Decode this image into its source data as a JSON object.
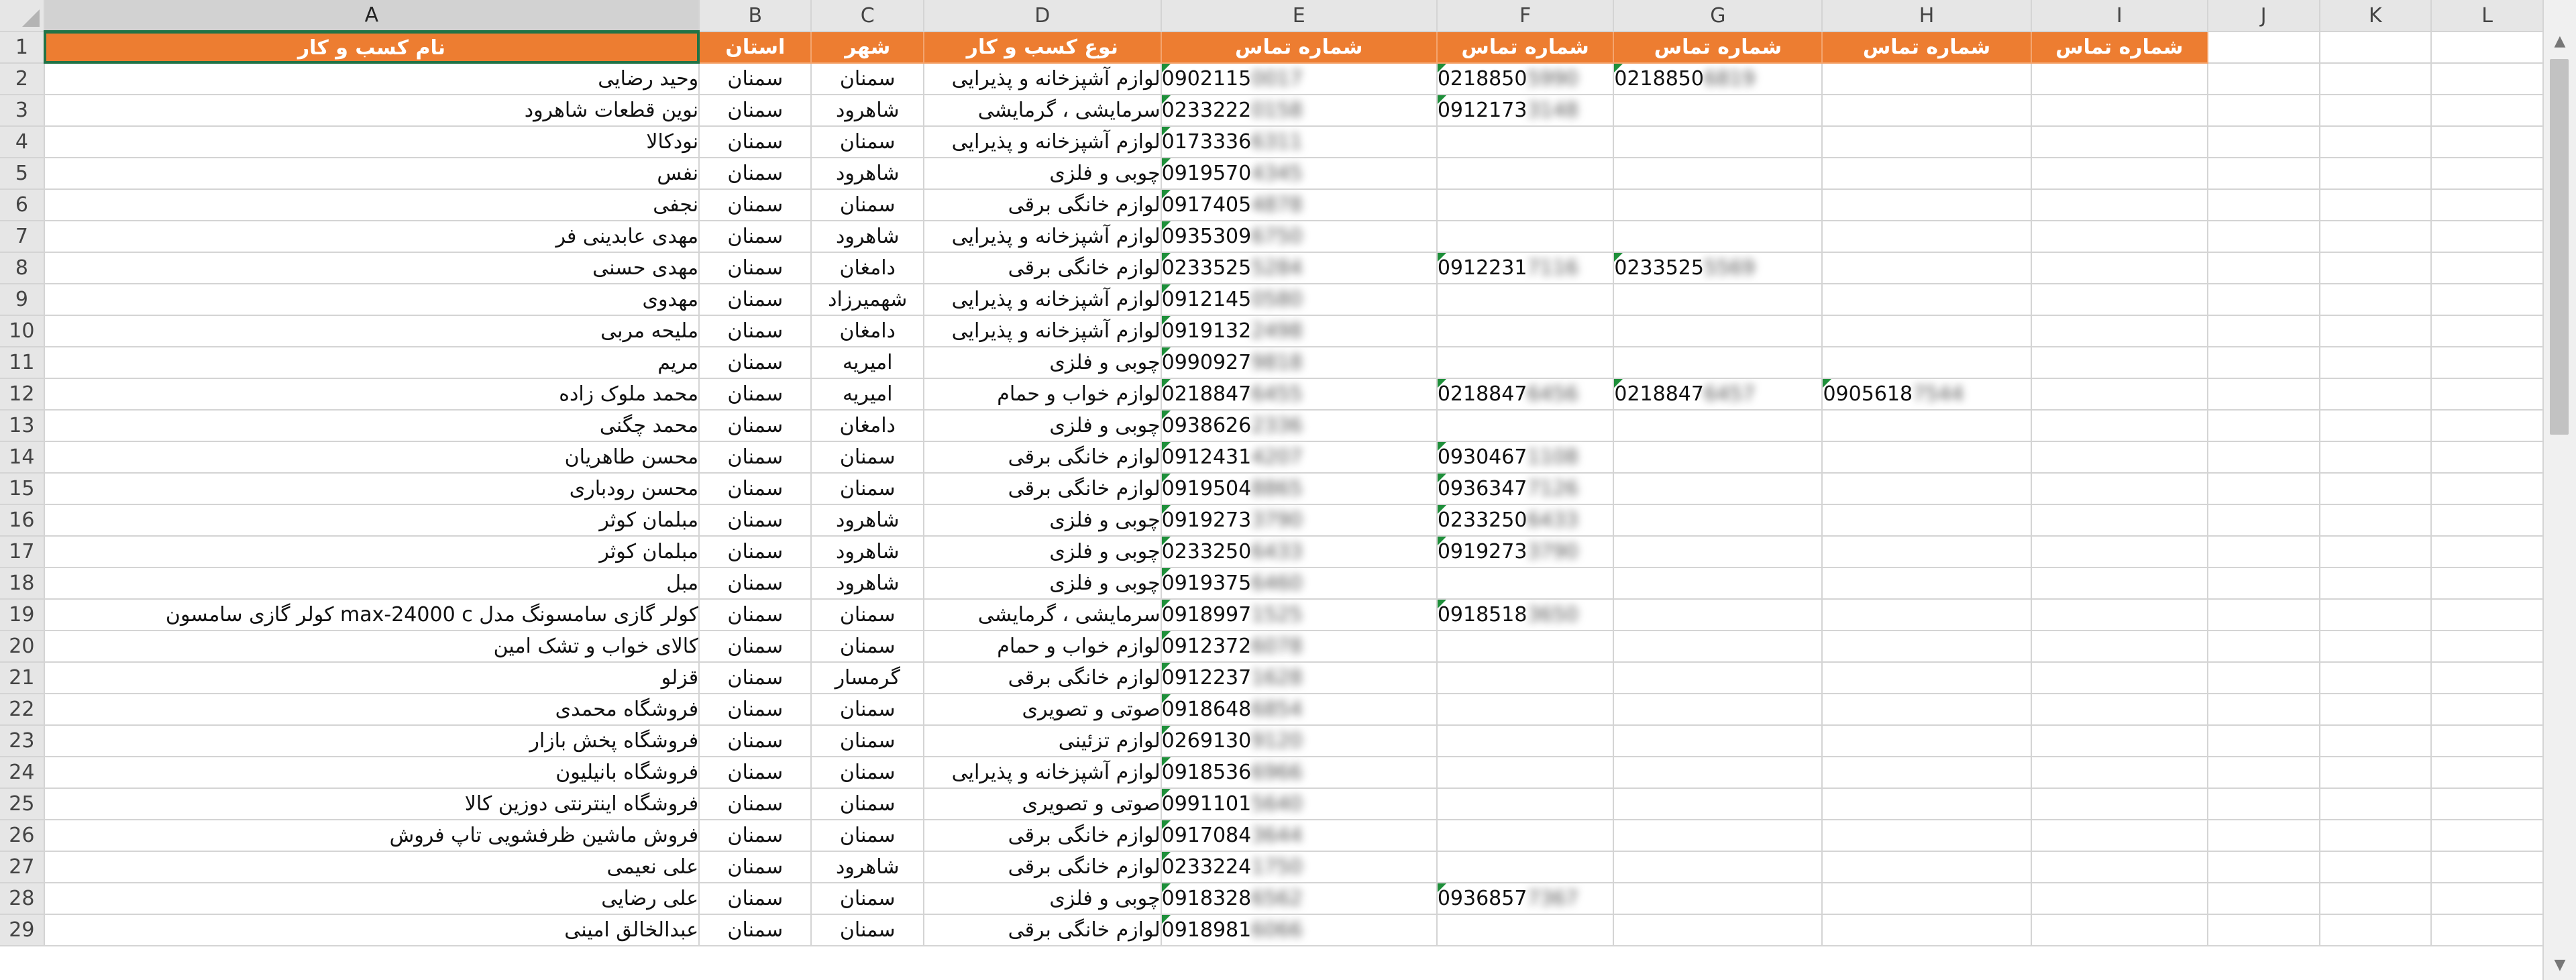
{
  "sheet": {
    "columns": [
      "A",
      "B",
      "C",
      "D",
      "E",
      "F",
      "G",
      "H",
      "I",
      "J",
      "K",
      "L"
    ],
    "selected_column": "A",
    "header_row": [
      "نام کسب و کار",
      "استان",
      "شهر",
      "نوع کسب و کار",
      "شماره تماس",
      "شماره تماس",
      "شماره تماس",
      "شماره تماس",
      "شماره تماس",
      "",
      "",
      ""
    ],
    "rows": [
      {
        "num": "2",
        "name": "وحید رضایی",
        "province": "سمنان",
        "city": "سمنان",
        "type": "لوازم آشپزخانه و پذیرایی",
        "phones": [
          {
            "v": "0902115",
            "h": "0017"
          },
          {
            "v": "0218850",
            "h": "5990"
          },
          {
            "v": "0218850",
            "h": "6819"
          },
          null,
          null
        ]
      },
      {
        "num": "3",
        "name": "نوین قطعات شاهرود",
        "province": "سمنان",
        "city": "شاهرود",
        "type": "سرمایشی ، گرمایشی",
        "phones": [
          {
            "v": "0233222",
            "h": "0158"
          },
          {
            "v": "0912173",
            "h": "3148"
          },
          null,
          null,
          null
        ]
      },
      {
        "num": "4",
        "name": "نودکالا",
        "province": "سمنان",
        "city": "سمنان",
        "type": "لوازم آشپزخانه و پذیرایی",
        "phones": [
          {
            "v": "0173336",
            "h": "6311"
          },
          null,
          null,
          null,
          null
        ]
      },
      {
        "num": "5",
        "name": "نفس",
        "province": "سمنان",
        "city": "شاهرود",
        "type": "چوبی و فلزی",
        "phones": [
          {
            "v": "0919570",
            "h": "4345"
          },
          null,
          null,
          null,
          null
        ]
      },
      {
        "num": "6",
        "name": "نجفی",
        "province": "سمنان",
        "city": "سمنان",
        "type": "لوازم خانگی برقی",
        "phones": [
          {
            "v": "0917405",
            "h": "4878"
          },
          null,
          null,
          null,
          null
        ]
      },
      {
        "num": "7",
        "name": "مهدی عابدینی فر",
        "province": "سمنان",
        "city": "شاهرود",
        "type": "لوازم آشپزخانه و پذیرایی",
        "phones": [
          {
            "v": "0935309",
            "h": "6750"
          },
          null,
          null,
          null,
          null
        ]
      },
      {
        "num": "8",
        "name": "مهدی حسنی",
        "province": "سمنان",
        "city": "دامغان",
        "type": "لوازم خانگی برقی",
        "phones": [
          {
            "v": "0233525",
            "h": "5284"
          },
          {
            "v": "0912231",
            "h": "7116"
          },
          {
            "v": "0233525",
            "h": "5569"
          },
          null,
          null
        ]
      },
      {
        "num": "9",
        "name": "مهدوی",
        "province": "سمنان",
        "city": "شهمیرزاد",
        "type": "لوازم آشپزخانه و پذیرایی",
        "phones": [
          {
            "v": "0912145",
            "h": "0580"
          },
          null,
          null,
          null,
          null
        ]
      },
      {
        "num": "10",
        "name": "ملیحه مربی",
        "province": "سمنان",
        "city": "دامغان",
        "type": "لوازم آشپزخانه و پذیرایی",
        "phones": [
          {
            "v": "0919132",
            "h": "2498"
          },
          null,
          null,
          null,
          null
        ]
      },
      {
        "num": "11",
        "name": "مریم",
        "province": "سمنان",
        "city": "امیریه",
        "type": "چوبی و فلزی",
        "phones": [
          {
            "v": "0990927",
            "h": "9818"
          },
          null,
          null,
          null,
          null
        ]
      },
      {
        "num": "12",
        "name": "محمد ملوک زاده",
        "province": "سمنان",
        "city": "امیریه",
        "type": "لوازم خواب و حمام",
        "phones": [
          {
            "v": "0218847",
            "h": "6455"
          },
          {
            "v": "0218847",
            "h": "6456"
          },
          {
            "v": "0218847",
            "h": "6457"
          },
          {
            "v": "0905618",
            "h": "7544"
          },
          null
        ]
      },
      {
        "num": "13",
        "name": "محمد چگنی",
        "province": "سمنان",
        "city": "دامغان",
        "type": "چوبی و فلزی",
        "phones": [
          {
            "v": "0938626",
            "h": "2336"
          },
          null,
          null,
          null,
          null
        ]
      },
      {
        "num": "14",
        "name": "محسن طاهریان",
        "province": "سمنان",
        "city": "سمنان",
        "type": "لوازم خانگی برقی",
        "phones": [
          {
            "v": "0912431",
            "h": "4207"
          },
          {
            "v": "0930467",
            "h": "1108"
          },
          null,
          null,
          null
        ]
      },
      {
        "num": "15",
        "name": "محسن رودباری",
        "province": "سمنان",
        "city": "سمنان",
        "type": "لوازم خانگی برقی",
        "phones": [
          {
            "v": "0919504",
            "h": "8865"
          },
          {
            "v": "0936347",
            "h": "7126"
          },
          null,
          null,
          null
        ]
      },
      {
        "num": "16",
        "name": "مبلمان کوثر",
        "province": "سمنان",
        "city": "شاهرود",
        "type": "چوبی و فلزی",
        "phones": [
          {
            "v": "0919273",
            "h": "3790"
          },
          {
            "v": "0233250",
            "h": "6433"
          },
          null,
          null,
          null
        ]
      },
      {
        "num": "17",
        "name": "مبلمان کوثر",
        "province": "سمنان",
        "city": "شاهرود",
        "type": "چوبی و فلزی",
        "phones": [
          {
            "v": "0233250",
            "h": "6433"
          },
          {
            "v": "0919273",
            "h": "3790"
          },
          null,
          null,
          null
        ]
      },
      {
        "num": "18",
        "name": "مبل",
        "province": "سمنان",
        "city": "شاهرود",
        "type": "چوبی و فلزی",
        "phones": [
          {
            "v": "0919375",
            "h": "6460"
          },
          null,
          null,
          null,
          null
        ]
      },
      {
        "num": "19",
        "name": "کولر گازی سامسونگ مدل max-24000 c کولر گازی سامسون",
        "province": "سمنان",
        "city": "سمنان",
        "type": "سرمایشی ، گرمایشی",
        "phones": [
          {
            "v": "0918997",
            "h": "1525"
          },
          {
            "v": "0918518",
            "h": "3650"
          },
          null,
          null,
          null
        ]
      },
      {
        "num": "20",
        "name": "کالای خواب و تشک امین",
        "province": "سمنان",
        "city": "سمنان",
        "type": "لوازم خواب و حمام",
        "phones": [
          {
            "v": "0912372",
            "h": "6078"
          },
          null,
          null,
          null,
          null
        ]
      },
      {
        "num": "21",
        "name": "قزلو",
        "province": "سمنان",
        "city": "گرمسار",
        "type": "لوازم خانگی برقی",
        "phones": [
          {
            "v": "0912237",
            "h": "1628"
          },
          null,
          null,
          null,
          null
        ]
      },
      {
        "num": "22",
        "name": "فروشگاه محمدی",
        "province": "سمنان",
        "city": "سمنان",
        "type": "صوتی و تصویری",
        "phones": [
          {
            "v": "0918648",
            "h": "6854"
          },
          null,
          null,
          null,
          null
        ]
      },
      {
        "num": "23",
        "name": "فروشگاه پخش بازار",
        "province": "سمنان",
        "city": "سمنان",
        "type": "لوازم تزئینی",
        "phones": [
          {
            "v": "0269130",
            "h": "9120"
          },
          null,
          null,
          null,
          null
        ]
      },
      {
        "num": "24",
        "name": "فروشگاه بانیلیون",
        "province": "سمنان",
        "city": "سمنان",
        "type": "لوازم آشپزخانه و پذیرایی",
        "phones": [
          {
            "v": "0918536",
            "h": "6966"
          },
          null,
          null,
          null,
          null
        ]
      },
      {
        "num": "25",
        "name": "فروشگاه اینترنتی دوزین کالا",
        "province": "سمنان",
        "city": "سمنان",
        "type": "صوتی و تصویری",
        "phones": [
          {
            "v": "0991101",
            "h": "5640"
          },
          null,
          null,
          null,
          null
        ]
      },
      {
        "num": "26",
        "name": "فروش ماشین ظرفشویی تاپ فروش",
        "province": "سمنان",
        "city": "سمنان",
        "type": "لوازم خانگی برقی",
        "phones": [
          {
            "v": "0917084",
            "h": "3644"
          },
          null,
          null,
          null,
          null
        ]
      },
      {
        "num": "27",
        "name": "علی نعیمی",
        "province": "سمنان",
        "city": "شاهرود",
        "type": "لوازم خانگی برقی",
        "phones": [
          {
            "v": "0233224",
            "h": "1750"
          },
          null,
          null,
          null,
          null
        ]
      },
      {
        "num": "28",
        "name": "علی رضایی",
        "province": "سمنان",
        "city": "سمنان",
        "type": "چوبی و فلزی",
        "phones": [
          {
            "v": "0918328",
            "h": "6562"
          },
          {
            "v": "0936857",
            "h": "7367"
          },
          null,
          null,
          null
        ]
      },
      {
        "num": "29",
        "name": "عبدالخالق امینی",
        "province": "سمنان",
        "city": "سمنان",
        "type": "لوازم خانگی برقی",
        "phones": [
          {
            "v": "0918981",
            "h": "6066"
          },
          null,
          null,
          null,
          null
        ]
      }
    ]
  },
  "colors": {
    "header_fill": "#ed7d31",
    "selection": "#217346",
    "grid": "#d4d4d4",
    "note_tag": "#1e8f3a"
  }
}
